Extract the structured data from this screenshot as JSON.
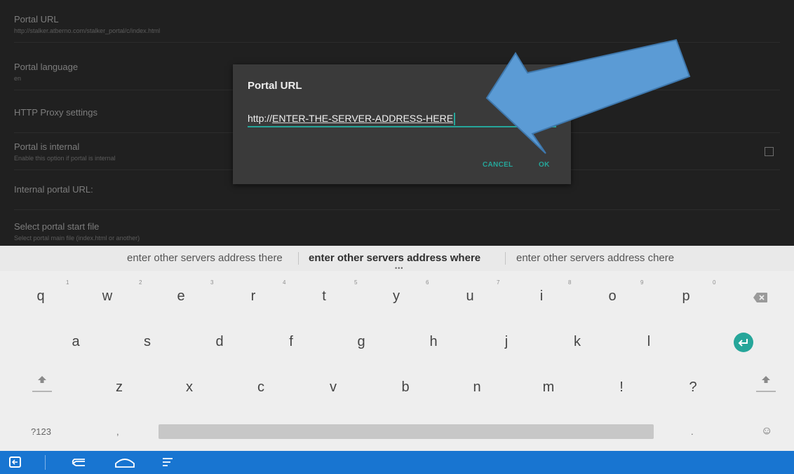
{
  "settings": {
    "items": [
      {
        "title": "Portal URL",
        "subtitle": "http://stalker.atberno.com/stalker_portal/c/index.html"
      },
      {
        "title": "Portal language",
        "subtitle": "en"
      },
      {
        "title": "HTTP Proxy settings",
        "subtitle": ""
      },
      {
        "title": "Portal is internal",
        "subtitle": "Enable this option if portal is internal"
      },
      {
        "title": "Internal portal URL:",
        "subtitle": ""
      },
      {
        "title": "Select portal start file",
        "subtitle": "Select portal main file (index.html or another)"
      }
    ]
  },
  "dialog": {
    "title": "Portal URL",
    "input_prefix": "http://",
    "input_selected": "ENTER-THE-SERVER-ADDRESS-HERE",
    "cancel_label": "CANCEL",
    "ok_label": "OK"
  },
  "suggestions": [
    "enter other servers address there",
    "enter other servers address where",
    "enter other servers address chere"
  ],
  "keyboard": {
    "row1": [
      "q",
      "w",
      "e",
      "r",
      "t",
      "y",
      "u",
      "i",
      "o",
      "p"
    ],
    "row1_hints": [
      "1",
      "2",
      "3",
      "4",
      "5",
      "6",
      "7",
      "8",
      "9",
      "0"
    ],
    "row2": [
      "a",
      "s",
      "d",
      "f",
      "g",
      "h",
      "j",
      "k",
      "l"
    ],
    "row3": [
      "z",
      "x",
      "c",
      "v",
      "b",
      "n",
      "m",
      "!",
      "?"
    ],
    "symbols_label": "?123",
    "comma": ",",
    "period": ".",
    "emoji_symbol": "☺"
  },
  "icons": {
    "backspace": "backspace-icon",
    "enter": "enter-icon",
    "shift": "shift-icon",
    "emoji": "emoji-icon",
    "back": "back-icon",
    "home": "home-icon",
    "recents": "recents-icon",
    "keyboard_switch": "keyboard-switch-icon"
  },
  "colors": {
    "accent": "#26a69a",
    "navbar": "#1875d1",
    "annotation_arrow": "#5b9bd5"
  }
}
